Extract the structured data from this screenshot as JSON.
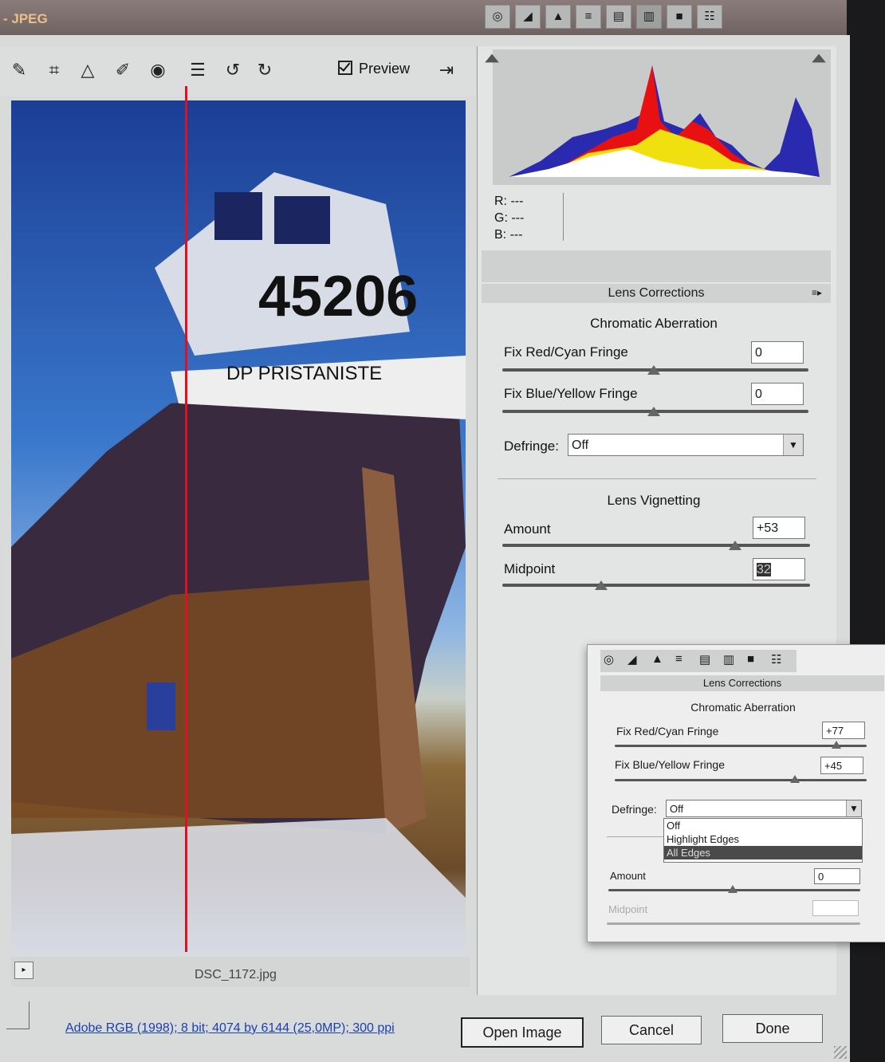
{
  "window": {
    "title": "- JPEG"
  },
  "toolbar": {
    "icons": [
      "eyedropper-icon",
      "crop-icon",
      "straighten-icon",
      "retouch-icon",
      "red-eye-icon",
      "preferences-icon",
      "rotate-left-icon",
      "rotate-right-icon"
    ],
    "preview_label": "Preview",
    "preview_checked": true
  },
  "image": {
    "filename": "DSC_1172.jpg",
    "boat_number": "45206",
    "boat_name": "DP PRISTANISTE"
  },
  "histogram": {
    "channels": [
      "red",
      "green",
      "blue",
      "yellow",
      "cyan",
      "white"
    ]
  },
  "readout": {
    "r": "R:  ---",
    "g": "G:  ---",
    "b": "B:  ---"
  },
  "panel": {
    "tabs": [
      "basic-icon",
      "tone-curve-icon",
      "detail-icon",
      "hsl-icon",
      "split-tone-icon",
      "lens-icon",
      "camera-calibration-icon",
      "presets-icon"
    ],
    "title": "Lens Corrections",
    "chromatic_section": "Chromatic Aberration",
    "red_cyan_label": "Fix Red/Cyan Fringe",
    "red_cyan_value": "0",
    "blue_yellow_label": "Fix Blue/Yellow Fringe",
    "blue_yellow_value": "0",
    "defringe_label": "Defringe:",
    "defringe_value": "Off",
    "vignetting_section": "Lens Vignetting",
    "amount_label": "Amount",
    "amount_value": "+53",
    "midpoint_label": "Midpoint",
    "midpoint_value": "32"
  },
  "inset": {
    "title": "Lens Corrections",
    "chromatic_section": "Chromatic Aberration",
    "red_cyan_label": "Fix Red/Cyan Fringe",
    "red_cyan_value": "+77",
    "blue_yellow_label": "Fix Blue/Yellow Fringe",
    "blue_yellow_value": "+45",
    "defringe_label": "Defringe:",
    "defringe_value": "Off",
    "defringe_options": [
      "Off",
      "Highlight Edges",
      "All Edges"
    ],
    "defringe_highlighted": "All Edges",
    "amount_label": "Amount",
    "amount_value": "0",
    "midpoint_label": "Midpoint",
    "midpoint_value": ""
  },
  "footer": {
    "workflow_link": "Adobe RGB (1998); 8 bit; 4074 by 6144 (25,0MP); 300 ppi",
    "open_label": "Open Image",
    "cancel_label": "Cancel",
    "done_label": "Done"
  }
}
